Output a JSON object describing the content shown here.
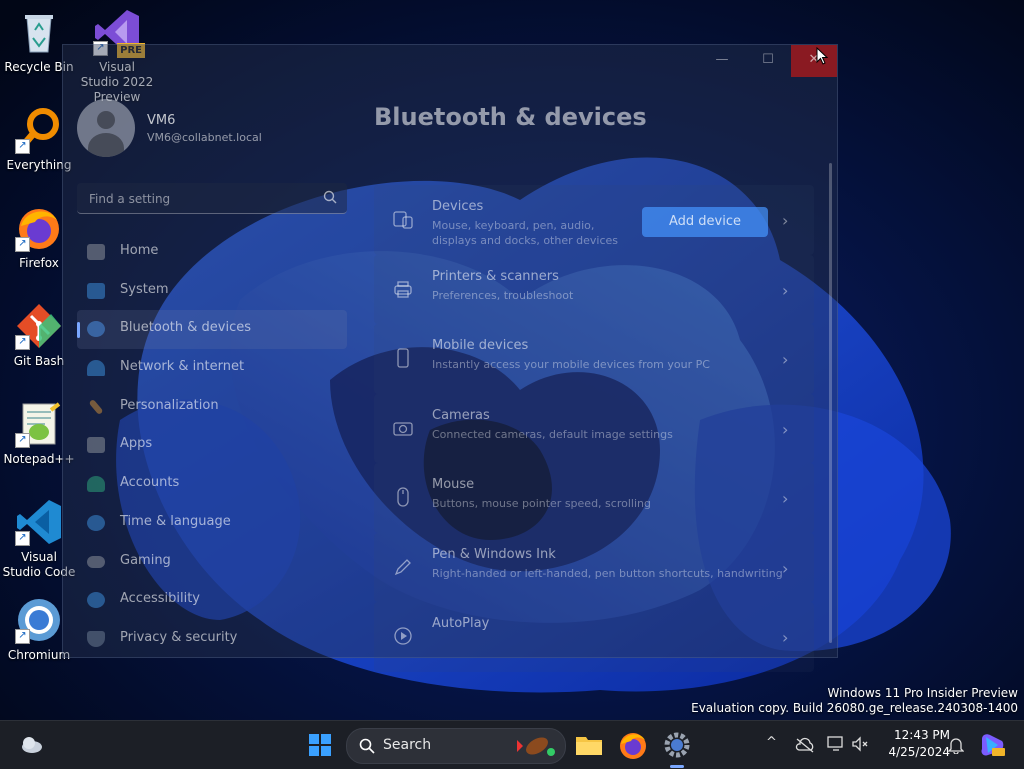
{
  "desktop": {
    "icons": [
      {
        "label": "Recycle Bin",
        "icon": "recycle-bin-icon"
      },
      {
        "label": "Visual Studio 2022 Preview",
        "badge": "PRE",
        "icon": "visual-studio-preview-icon"
      },
      {
        "label": "Everything",
        "icon": "everything-search-icon"
      },
      {
        "label": "Firefox",
        "icon": "firefox-icon"
      },
      {
        "label": "Git Bash",
        "icon": "git-bash-icon"
      },
      {
        "label": "Notepad++",
        "icon": "notepad-plus-plus-icon"
      },
      {
        "label": "Visual Studio Code",
        "icon": "vscode-icon"
      },
      {
        "label": "Chromium",
        "icon": "chromium-icon"
      }
    ]
  },
  "window": {
    "title_buttons": {
      "minimize": "—",
      "maximize": "☐",
      "close": "✕"
    },
    "account": {
      "name": "VM6",
      "email": "VM6@collabnet.local"
    },
    "search": {
      "placeholder": "Find a setting"
    },
    "nav": [
      {
        "label": "Home",
        "icon": "home-icon",
        "color": "#8a8f99"
      },
      {
        "label": "System",
        "icon": "monitor-icon",
        "color": "#3b8bd6"
      },
      {
        "label": "Bluetooth & devices",
        "icon": "bluetooth-icon",
        "color": "#4a90e2",
        "active": true
      },
      {
        "label": "Network & internet",
        "icon": "wifi-icon",
        "color": "#3b8bd6"
      },
      {
        "label": "Personalization",
        "icon": "brush-icon",
        "color": "#c88a3a"
      },
      {
        "label": "Apps",
        "icon": "apps-icon",
        "color": "#8a8f99"
      },
      {
        "label": "Accounts",
        "icon": "person-icon",
        "color": "#2ea37a"
      },
      {
        "label": "Time & language",
        "icon": "globe-clock-icon",
        "color": "#3b8bd6"
      },
      {
        "label": "Gaming",
        "icon": "gamepad-icon",
        "color": "#8a8f99"
      },
      {
        "label": "Accessibility",
        "icon": "accessibility-icon",
        "color": "#3b8bd6"
      },
      {
        "label": "Privacy & security",
        "icon": "shield-icon",
        "color": "#6a7a90"
      }
    ],
    "page_title": "Bluetooth & devices",
    "cards": [
      {
        "title": "Devices",
        "desc": "Mouse, keyboard, pen, audio, displays and docks, other devices",
        "icon": "devices-icon",
        "button": "Add device"
      },
      {
        "title": "Printers & scanners",
        "desc": "Preferences, troubleshoot",
        "icon": "printer-icon"
      },
      {
        "title": "Mobile devices",
        "desc": "Instantly access your mobile devices from your PC",
        "icon": "phone-icon"
      },
      {
        "title": "Cameras",
        "desc": "Connected cameras, default image settings",
        "icon": "camera-icon"
      },
      {
        "title": "Mouse",
        "desc": "Buttons, mouse pointer speed, scrolling",
        "icon": "mouse-icon"
      },
      {
        "title": "Pen & Windows Ink",
        "desc": "Right-handed or left-handed, pen button shortcuts, handwriting",
        "icon": "pen-icon"
      },
      {
        "title": "AutoPlay",
        "desc": "",
        "icon": "autoplay-icon"
      }
    ],
    "chevron": "›"
  },
  "watermark": {
    "line1": "Windows 11 Pro Insider Preview",
    "line2": "Evaluation copy. Build 26080.ge_release.240308-1400"
  },
  "taskbar": {
    "search_label": "Search",
    "time": "12:43 PM",
    "date": "4/25/2024",
    "tray_chevron": "^"
  }
}
